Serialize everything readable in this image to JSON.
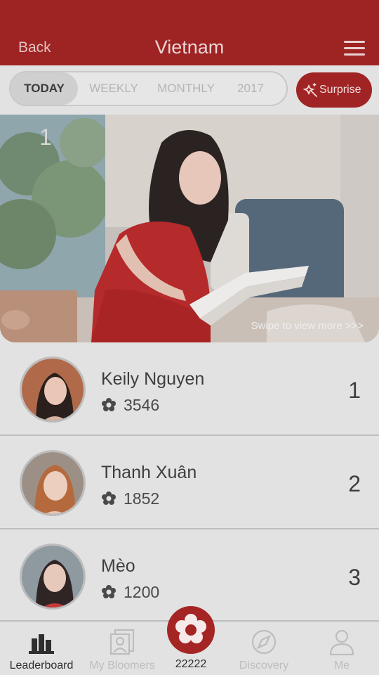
{
  "header": {
    "back_label": "Back",
    "title": "Vietnam"
  },
  "filters": {
    "tabs": [
      {
        "label": "TODAY",
        "active": true
      },
      {
        "label": "WEEKLY",
        "active": false
      },
      {
        "label": "MONTHLY",
        "active": false
      },
      {
        "label": "2017",
        "active": false
      }
    ],
    "surprise_label": "Surprise"
  },
  "hero": {
    "rank": "1",
    "swipe_hint": "Swipe to view more >>>"
  },
  "leaderboard": [
    {
      "name": "Keily Nguyen",
      "score": "3546",
      "rank": "1"
    },
    {
      "name": "Thanh Xuân",
      "score": "1852",
      "rank": "2"
    },
    {
      "name": "Mèo",
      "score": "1200",
      "rank": "3"
    }
  ],
  "tabbar": {
    "items": [
      {
        "label": "Leaderboard",
        "icon": "leaderboard-icon",
        "active": true
      },
      {
        "label": "My Bloomers",
        "icon": "bloomers-icon",
        "active": false
      },
      {
        "label": "22222",
        "icon": "flower-logo-icon",
        "active": false
      },
      {
        "label": "Discovery",
        "icon": "compass-icon",
        "active": false
      },
      {
        "label": "Me",
        "icon": "person-icon",
        "active": false
      }
    ]
  },
  "colors": {
    "brand_red": "#9e2323",
    "overlay_gray": "#e2e2e2",
    "active_text": "#2e2e2e"
  }
}
